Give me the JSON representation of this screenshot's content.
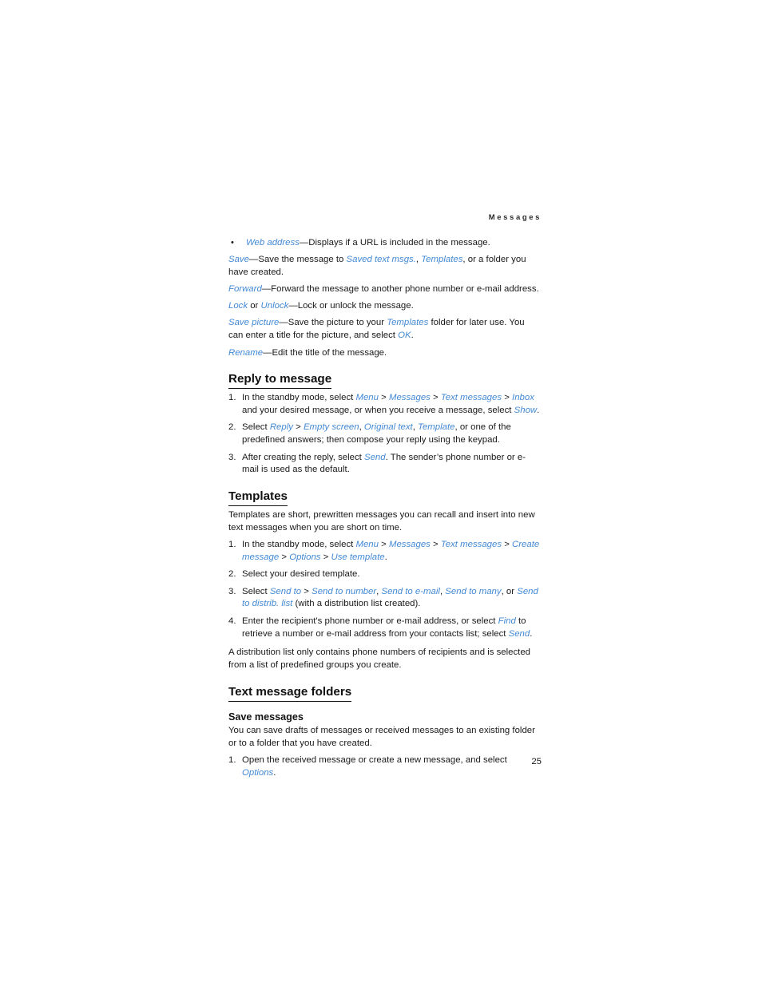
{
  "running_head": "Messages",
  "page_number": "25",
  "colors": {
    "ui_link": "#4389d4",
    "text": "#1a1a1a",
    "heading": "#111111"
  },
  "intro_options": {
    "bullet": [
      {
        "ui": "Web address",
        "text": "—Displays if a URL is included in the message."
      }
    ],
    "paragraphs": [
      {
        "id": "save",
        "segments": [
          {
            "type": "ui",
            "text": "Save"
          },
          {
            "type": "plain",
            "text": "—Save the message to "
          },
          {
            "type": "ui",
            "text": "Saved text msgs."
          },
          {
            "type": "plain",
            "text": ", "
          },
          {
            "type": "ui",
            "text": "Templates"
          },
          {
            "type": "plain",
            "text": ", or a folder you have created."
          }
        ]
      },
      {
        "id": "forward",
        "segments": [
          {
            "type": "ui",
            "text": "Forward"
          },
          {
            "type": "plain",
            "text": "—Forward the message to another phone number or e-mail address."
          }
        ]
      },
      {
        "id": "lock-unlock",
        "segments": [
          {
            "type": "ui",
            "text": "Lock"
          },
          {
            "type": "plain",
            "text": " or "
          },
          {
            "type": "ui",
            "text": "Unlock"
          },
          {
            "type": "plain",
            "text": "—Lock or unlock the message."
          }
        ]
      },
      {
        "id": "save-picture",
        "segments": [
          {
            "type": "ui",
            "text": "Save picture"
          },
          {
            "type": "plain",
            "text": "—Save the picture to your "
          },
          {
            "type": "ui",
            "text": "Templates"
          },
          {
            "type": "plain",
            "text": " folder for later use. You can enter a title for the picture, and select "
          },
          {
            "type": "ui",
            "text": "OK"
          },
          {
            "type": "plain",
            "text": "."
          }
        ]
      },
      {
        "id": "rename",
        "segments": [
          {
            "type": "ui",
            "text": "Rename"
          },
          {
            "type": "plain",
            "text": "—Edit the title of the message."
          }
        ]
      }
    ]
  },
  "sections": [
    {
      "id": "reply-to-message",
      "heading": "Reply to message",
      "heading_level": 1,
      "steps": [
        {
          "num": "1.",
          "segments": [
            {
              "type": "plain",
              "text": "In the standby mode, select "
            },
            {
              "type": "ui",
              "text": "Menu"
            },
            {
              "type": "plain",
              "text": " > "
            },
            {
              "type": "ui",
              "text": "Messages"
            },
            {
              "type": "plain",
              "text": " > "
            },
            {
              "type": "ui",
              "text": "Text messages"
            },
            {
              "type": "plain",
              "text": " > "
            },
            {
              "type": "ui",
              "text": "Inbox"
            },
            {
              "type": "plain",
              "text": " and your desired message, or when you receive a message, select "
            },
            {
              "type": "ui",
              "text": "Show"
            },
            {
              "type": "plain",
              "text": "."
            }
          ]
        },
        {
          "num": "2.",
          "segments": [
            {
              "type": "plain",
              "text": "Select "
            },
            {
              "type": "ui",
              "text": "Reply"
            },
            {
              "type": "plain",
              "text": " > "
            },
            {
              "type": "ui",
              "text": "Empty screen"
            },
            {
              "type": "plain",
              "text": ", "
            },
            {
              "type": "ui",
              "text": "Original text"
            },
            {
              "type": "plain",
              "text": ", "
            },
            {
              "type": "ui",
              "text": "Template"
            },
            {
              "type": "plain",
              "text": ", or one of the predefined answers; then compose your reply using the keypad."
            }
          ]
        },
        {
          "num": "3.",
          "segments": [
            {
              "type": "plain",
              "text": "After creating the reply, select "
            },
            {
              "type": "ui",
              "text": "Send"
            },
            {
              "type": "plain",
              "text": ". The sender’s phone number or e-mail is used as the default."
            }
          ]
        }
      ]
    },
    {
      "id": "templates",
      "heading": "Templates",
      "heading_level": 1,
      "lead": "Templates are short, prewritten messages you can recall and insert into new text messages when you are short on time.",
      "steps": [
        {
          "num": "1.",
          "segments": [
            {
              "type": "plain",
              "text": "In the standby mode, select "
            },
            {
              "type": "ui",
              "text": "Menu"
            },
            {
              "type": "plain",
              "text": " > "
            },
            {
              "type": "ui",
              "text": "Messages"
            },
            {
              "type": "plain",
              "text": " > "
            },
            {
              "type": "ui",
              "text": "Text messages"
            },
            {
              "type": "plain",
              "text": " > "
            },
            {
              "type": "ui",
              "text": "Create message"
            },
            {
              "type": "plain",
              "text": " > "
            },
            {
              "type": "ui",
              "text": "Options"
            },
            {
              "type": "plain",
              "text": " > "
            },
            {
              "type": "ui",
              "text": "Use template"
            },
            {
              "type": "plain",
              "text": "."
            }
          ]
        },
        {
          "num": "2.",
          "segments": [
            {
              "type": "plain",
              "text": "Select your desired template."
            }
          ]
        },
        {
          "num": "3.",
          "segments": [
            {
              "type": "plain",
              "text": "Select "
            },
            {
              "type": "ui",
              "text": "Send to"
            },
            {
              "type": "plain",
              "text": " > "
            },
            {
              "type": "ui",
              "text": "Send to number"
            },
            {
              "type": "plain",
              "text": ", "
            },
            {
              "type": "ui",
              "text": "Send to e-mail"
            },
            {
              "type": "plain",
              "text": ", "
            },
            {
              "type": "ui",
              "text": "Send to many"
            },
            {
              "type": "plain",
              "text": ", or "
            },
            {
              "type": "ui",
              "text": "Send to distrib. list"
            },
            {
              "type": "plain",
              "text": " (with a distribution list created)."
            }
          ]
        },
        {
          "num": "4.",
          "segments": [
            {
              "type": "plain",
              "text": "Enter the recipient's phone number or e-mail address, or select "
            },
            {
              "type": "ui",
              "text": "Find"
            },
            {
              "type": "plain",
              "text": " to retrieve a number or e-mail address from your contacts list; select "
            },
            {
              "type": "ui",
              "text": "Send"
            },
            {
              "type": "plain",
              "text": "."
            }
          ]
        }
      ],
      "trailing": "A distribution list only contains phone numbers of recipients and is selected from a list of predefined groups you create."
    },
    {
      "id": "text-message-folders",
      "heading": "Text message folders",
      "heading_level": 1,
      "subsections": [
        {
          "id": "save-messages",
          "heading": "Save messages",
          "heading_level": 2,
          "lead": "You can save drafts of messages or received messages to an existing folder or to a folder that you have created.",
          "steps": [
            {
              "num": "1.",
              "segments": [
                {
                  "type": "plain",
                  "text": "Open the received message or create a new message, and select "
                },
                {
                  "type": "ui",
                  "text": "Options"
                },
                {
                  "type": "plain",
                  "text": "."
                }
              ]
            }
          ]
        }
      ]
    }
  ]
}
